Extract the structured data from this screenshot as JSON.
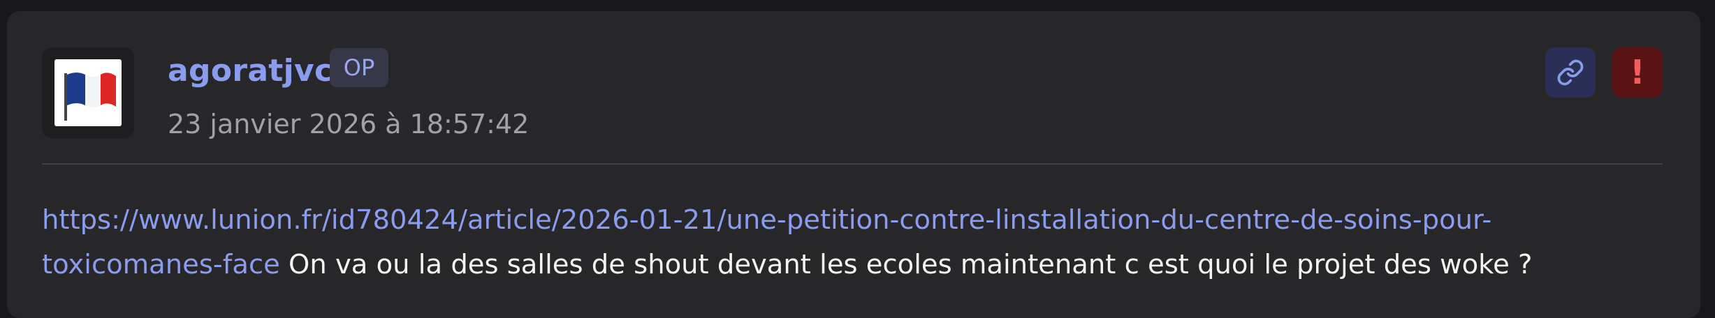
{
  "post": {
    "author": "agoratjvc",
    "op_badge": "OP",
    "timestamp": "23 janvier 2026 à 18:57:42",
    "body": {
      "link_line1": "https://www.lunion.fr/id780424/article/2026-01-21/une-petition-contre-linstallation-du-centre-de-soins-pour-",
      "link_line2": "toxicomanes-face",
      "text": " On va ou la des salles de shout devant les ecoles maintenant c est quoi le projet des woke ?"
    },
    "actions": {
      "permalink_icon": "link-icon",
      "report_icon": "exclamation-icon",
      "report_glyph": "!"
    }
  },
  "colors": {
    "accent": "#8a9cf0",
    "card_bg": "#27272a",
    "page_bg": "#18181b",
    "report_bg": "#5b1213",
    "link_button_bg": "#2b2f56"
  }
}
